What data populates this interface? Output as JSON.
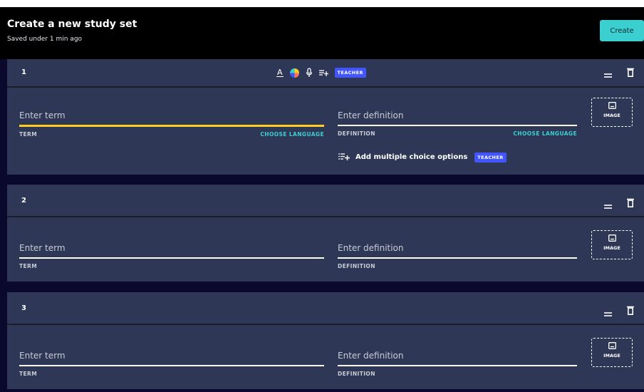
{
  "header": {
    "title": "Create a new study set",
    "subtitle": "Saved under 1 min ago",
    "create_label": "Create"
  },
  "icons": {
    "text_format": "text-format-icon",
    "color": "color-picker-icon",
    "mic": "microphone-icon",
    "add_options": "add-list-icon",
    "drag": "drag-handle-icon",
    "delete": "trash-icon",
    "image": "image-icon"
  },
  "colors": {
    "background": "#0a092d",
    "card": "#2e3856",
    "accent_yellow": "#ffcd1f",
    "accent_teal": "#3ccfcf",
    "teacher_badge": "#4255ff"
  },
  "cards": [
    {
      "number": "1",
      "teacher_badge": "TEACHER",
      "term_placeholder": "Enter term",
      "term_label": "TERM",
      "term_choose_language": "CHOOSE LANGUAGE",
      "definition_placeholder": "Enter definition",
      "definition_label": "DEFINITION",
      "definition_choose_language": "CHOOSE LANGUAGE",
      "image_label": "IMAGE",
      "mc_label": "Add multiple choice options",
      "mc_badge": "TEACHER"
    },
    {
      "number": "2",
      "term_placeholder": "Enter term",
      "term_label": "TERM",
      "definition_placeholder": "Enter definition",
      "definition_label": "DEFINITION",
      "image_label": "IMAGE"
    },
    {
      "number": "3",
      "term_placeholder": "Enter term",
      "term_label": "TERM",
      "definition_placeholder": "Enter definition",
      "definition_label": "DEFINITION",
      "image_label": "IMAGE"
    }
  ]
}
